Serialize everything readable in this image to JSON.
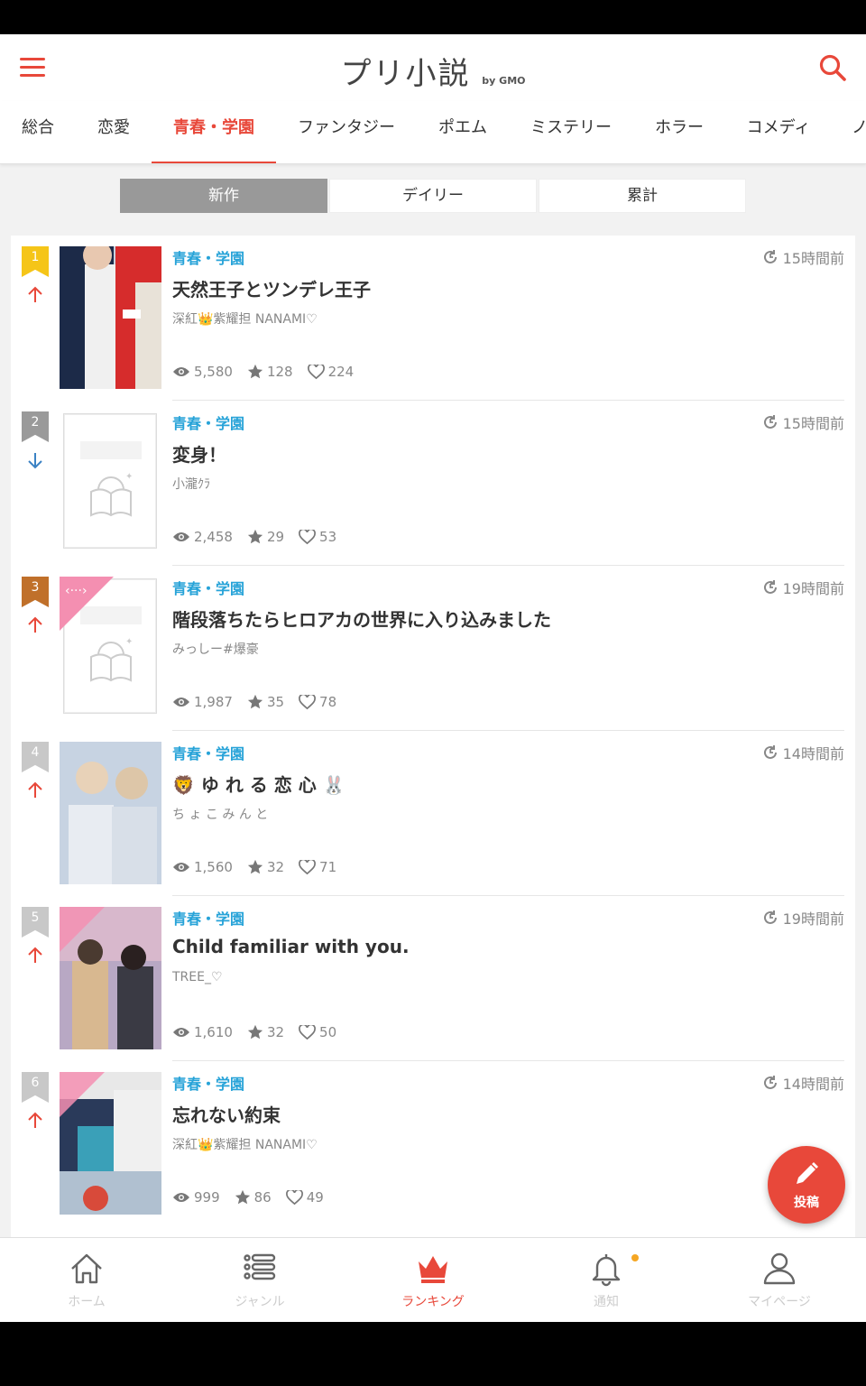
{
  "header": {
    "logo_text": "プリ小説",
    "logo_sub": "by GMO",
    "accent": "#e8483a"
  },
  "tabs": [
    "総合",
    "恋愛",
    "青春・学園",
    "ファンタジー",
    "ポエム",
    "ミステリー",
    "ホラー",
    "コメディ",
    "ノ"
  ],
  "active_tab": "青春・学園",
  "segments": [
    "新作",
    "デイリー",
    "累計"
  ],
  "active_segment": "新作",
  "items": [
    {
      "rank": "1",
      "rank_color": "#f5c518",
      "trend": "up",
      "category": "青春・学園",
      "time": "15時間前",
      "title": "天然王子とツンデレ王子",
      "author": "深紅👑紫耀担 NANAMI♡",
      "views": "5,580",
      "stars": "128",
      "likes": "224",
      "cover": "photo"
    },
    {
      "rank": "2",
      "rank_color": "#9a9a9a",
      "trend": "down",
      "category": "青春・学園",
      "time": "15時間前",
      "title": "変身！",
      "author": "小瀧ｸﾗ",
      "views": "2,458",
      "stars": "29",
      "likes": "53",
      "cover": "none"
    },
    {
      "rank": "3",
      "rank_color": "#c0702a",
      "trend": "up",
      "category": "青春・学園",
      "time": "19時間前",
      "title": "階段落ちたらヒロアカの世界に入り込みました",
      "author": "みっしー#爆豪",
      "views": "1,987",
      "stars": "35",
      "likes": "78",
      "cover": "none"
    },
    {
      "rank": "4",
      "rank_color": "#c8c8c8",
      "trend": "up",
      "category": "青春・学園",
      "time": "14時間前",
      "title": "🦁 ゆ れ る 恋 心 🐰",
      "author": "ち ょ こ み ん と",
      "views": "1,560",
      "stars": "32",
      "likes": "71",
      "cover": "photo"
    },
    {
      "rank": "5",
      "rank_color": "#c8c8c8",
      "trend": "up",
      "category": "青春・学園",
      "time": "19時間前",
      "title": "Child familiar with you.",
      "author": "TREE_♡",
      "views": "1,610",
      "stars": "32",
      "likes": "50",
      "cover": "photo"
    },
    {
      "rank": "6",
      "rank_color": "#c8c8c8",
      "trend": "up",
      "category": "青春・学園",
      "time": "14時間前",
      "title": "忘れない約束",
      "author": "深紅👑紫耀担 NANAMI♡",
      "views": "999",
      "stars": "86",
      "likes": "49",
      "cover": "photo"
    }
  ],
  "fab_label": "投稿",
  "bottom_nav": [
    {
      "label": "ホーム",
      "icon": "home-icon"
    },
    {
      "label": "ジャンル",
      "icon": "list-icon"
    },
    {
      "label": "ランキング",
      "icon": "crown-icon"
    },
    {
      "label": "通知",
      "icon": "bell-icon"
    },
    {
      "label": "マイページ",
      "icon": "user-icon"
    }
  ],
  "active_nav": "ランキング"
}
